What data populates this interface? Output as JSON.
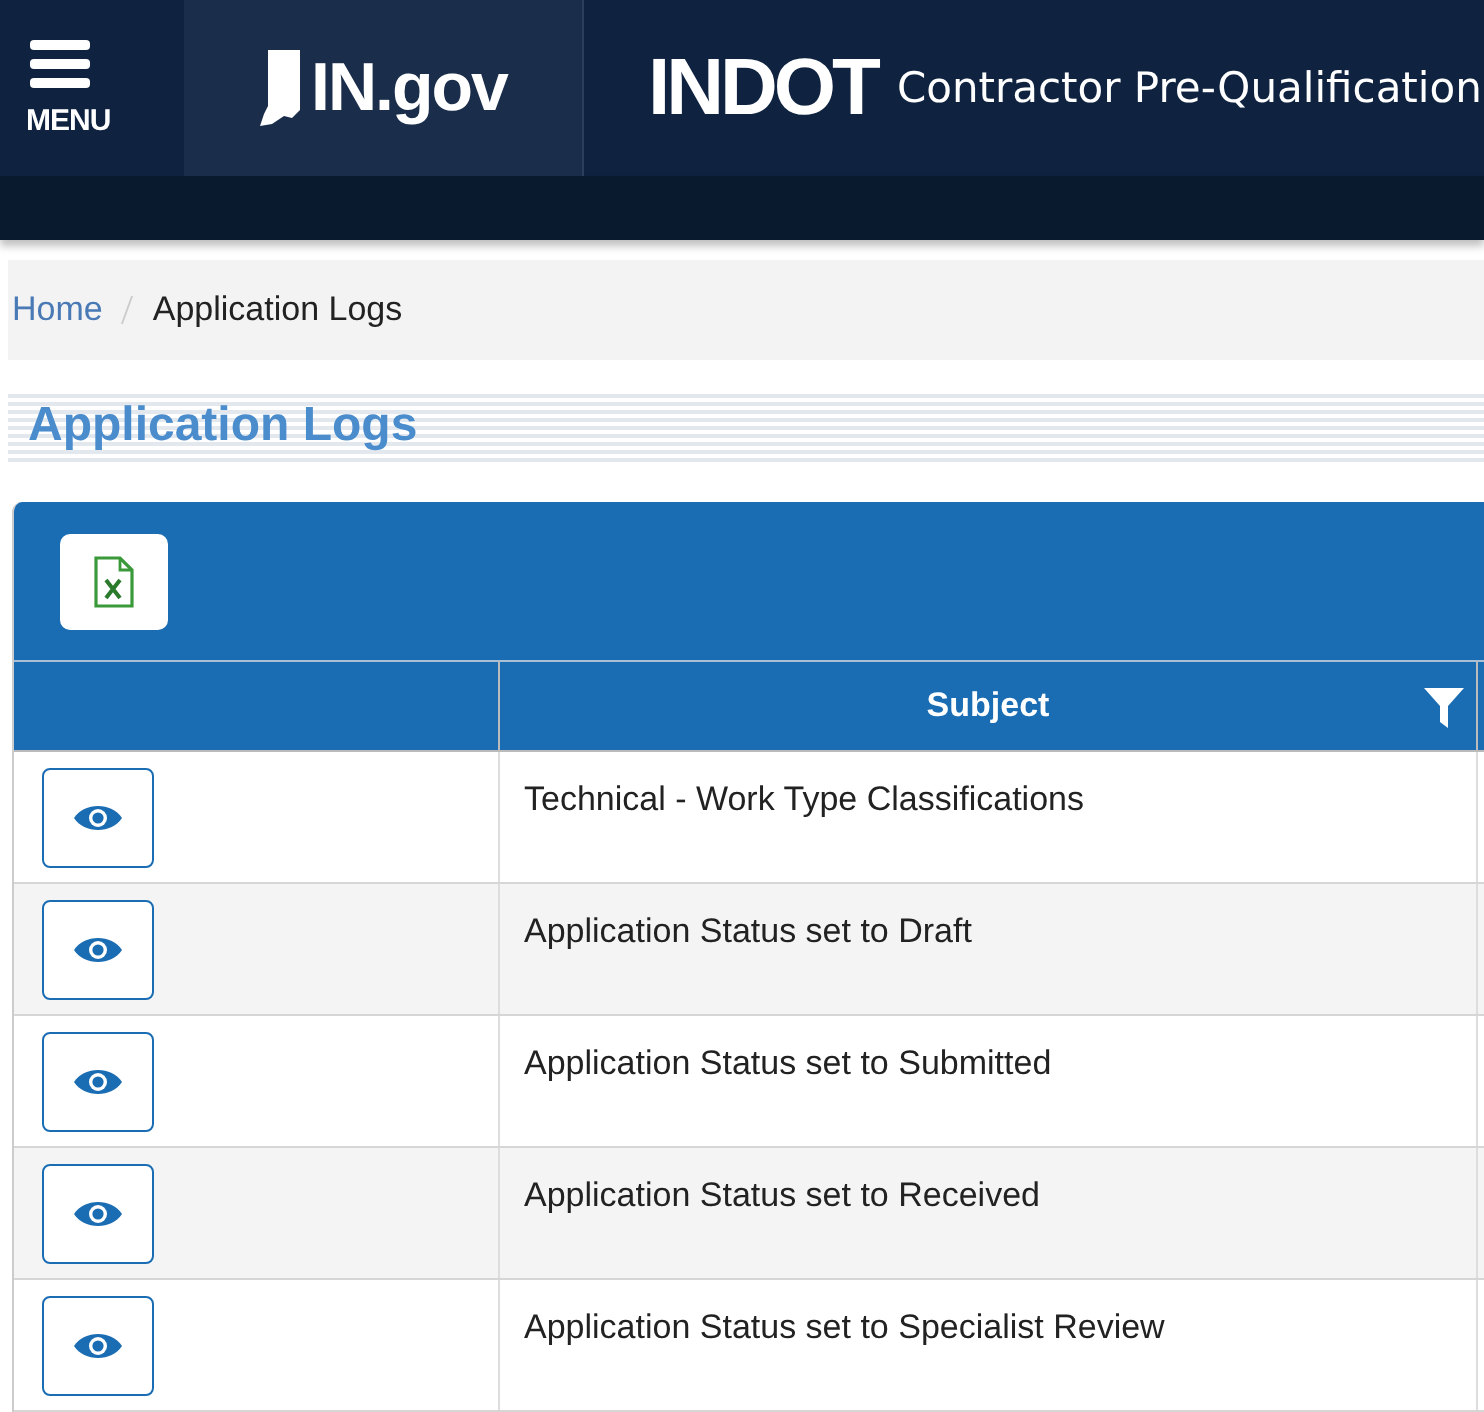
{
  "header": {
    "menu_label": "MENU",
    "logo_text": "IN.gov",
    "agency": "INDOT",
    "title": "Contractor Pre-Qualification"
  },
  "breadcrumb": [
    {
      "label": "Home",
      "kind": "link"
    },
    {
      "label": "Application Logs",
      "kind": "current"
    }
  ],
  "page_title": "Application Logs",
  "table": {
    "subject_header": "Subject",
    "rows": [
      {
        "subject": "Technical - Work Type Classifications"
      },
      {
        "subject": "Application Status set to Draft"
      },
      {
        "subject": "Application Status set to Submitted"
      },
      {
        "subject": "Application Status set to Received"
      },
      {
        "subject": "Application Status set to Specialist Review"
      }
    ]
  }
}
